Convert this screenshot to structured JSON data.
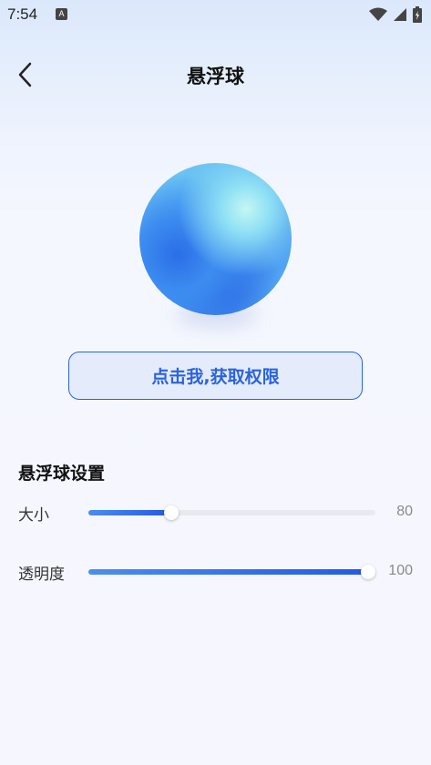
{
  "status_bar": {
    "time": "7:54",
    "notification_badge": "A",
    "icons": [
      "wifi-icon",
      "signal-icon",
      "battery-icon"
    ]
  },
  "header": {
    "title": "悬浮球",
    "back_icon": "chevron-left-icon"
  },
  "main": {
    "ball_colors": [
      "#c4f7f4",
      "#4aa6f2",
      "#2b6ee8"
    ],
    "permission_button_label": "点击我,获取权限",
    "settings_title": "悬浮球设置",
    "settings": [
      {
        "label": "大小",
        "value": "80",
        "fraction": 0.29
      },
      {
        "label": "透明度",
        "value": "100",
        "fraction": 1.0
      }
    ]
  },
  "colors": {
    "accent": "#2a63df",
    "button_bg": "#e4ebfb",
    "track": "#e8eaf0"
  }
}
